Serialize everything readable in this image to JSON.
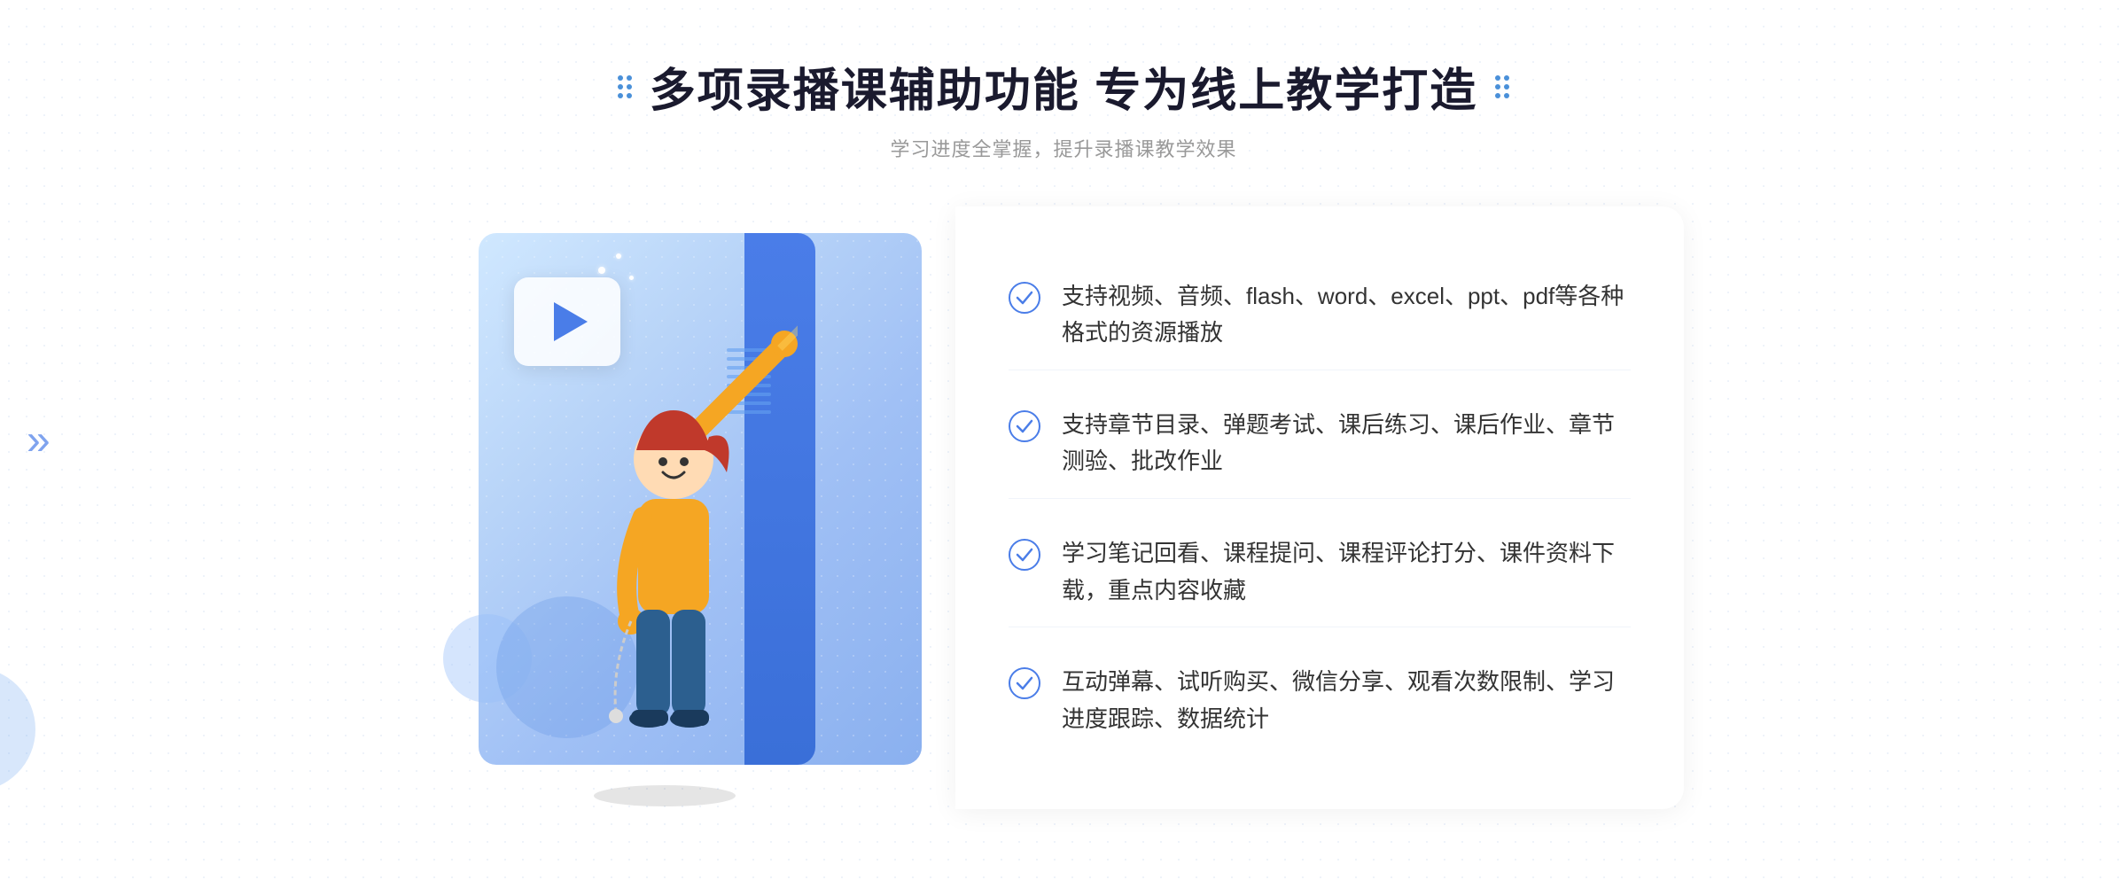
{
  "header": {
    "title": "多项录播课辅助功能 专为线上教学打造",
    "subtitle": "学习进度全掌握，提升录播课教学效果",
    "title_dots_label": "decorative dots"
  },
  "features": [
    {
      "id": "feature-1",
      "text": "支持视频、音频、flash、word、excel、ppt、pdf等各种格式的资源播放"
    },
    {
      "id": "feature-2",
      "text": "支持章节目录、弹题考试、课后练习、课后作业、章节测验、批改作业"
    },
    {
      "id": "feature-3",
      "text": "学习笔记回看、课程提问、课程评论打分、课件资料下载，重点内容收藏"
    },
    {
      "id": "feature-4",
      "text": "互动弹幕、试听购买、微信分享、观看次数限制、学习进度跟踪、数据统计"
    }
  ],
  "colors": {
    "accent_blue": "#4a7de8",
    "light_blue": "#d0e8ff",
    "text_dark": "#1a1a2e",
    "text_gray": "#999",
    "text_body": "#333"
  },
  "icons": {
    "check": "check-circle-icon",
    "play": "play-icon",
    "chevron": "chevron-left-icon"
  }
}
